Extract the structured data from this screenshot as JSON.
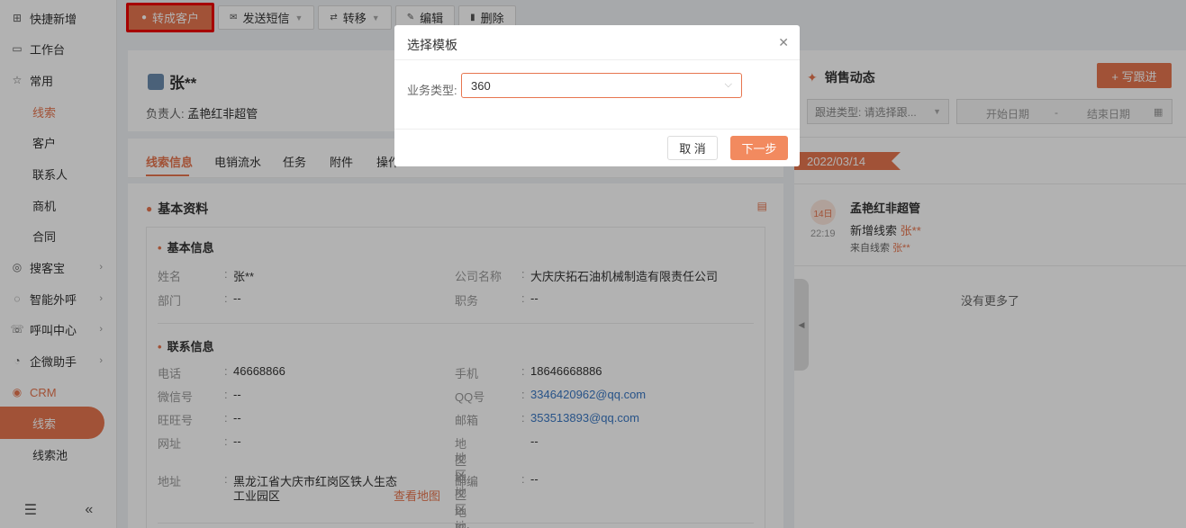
{
  "sidebar": {
    "items": [
      {
        "label": "快捷新增",
        "icon": "plus-square-icon"
      },
      {
        "label": "工作台",
        "icon": "monitor-icon"
      },
      {
        "label": "常用",
        "icon": "star-icon"
      },
      {
        "label": "线索"
      },
      {
        "label": "客户"
      },
      {
        "label": "联系人"
      },
      {
        "label": "商机"
      },
      {
        "label": "合同"
      },
      {
        "label": "搜客宝",
        "icon": "search-treasure-icon"
      },
      {
        "label": "智能外呼",
        "icon": "phone-bubble-icon"
      },
      {
        "label": "呼叫中心",
        "icon": "headset-icon"
      },
      {
        "label": "企微助手",
        "icon": "wecom-icon"
      },
      {
        "label": "CRM",
        "icon": "crm-icon"
      },
      {
        "label": "线索"
      },
      {
        "label": "线索池"
      }
    ]
  },
  "toolbar": {
    "convert": "转成客户",
    "sms": "发送短信",
    "transfer": "转移",
    "edit": "编辑",
    "delete": "删除"
  },
  "header": {
    "name": "张**",
    "owner_label": "负责人:",
    "owner": "孟艳红非超管"
  },
  "tabs": [
    "线索信息",
    "电销流水",
    "任务",
    "附件",
    "操作"
  ],
  "section": {
    "title": "基本资料",
    "basic_title": "基本信息",
    "contact_title": "联系信息"
  },
  "fields": {
    "name": {
      "k": "姓名",
      "v": "张**"
    },
    "company": {
      "k": "公司名称",
      "v": "大庆庆拓石油机械制造有限责任公司"
    },
    "dept": {
      "k": "部门",
      "v": "--"
    },
    "position": {
      "k": "职务",
      "v": "--"
    },
    "phone": {
      "k": "电话",
      "v": "46668866"
    },
    "mobile": {
      "k": "手机",
      "v": "18646668886"
    },
    "wechat": {
      "k": "微信号",
      "v": "--"
    },
    "qq": {
      "k": "QQ号",
      "v": "3346420962@qq.com"
    },
    "wangwang": {
      "k": "旺旺号",
      "v": "--"
    },
    "email": {
      "k": "邮箱",
      "v": "353513893@qq.com"
    },
    "website": {
      "k": "网址",
      "v": "--"
    },
    "region": {
      "k1": "地区地区地区:",
      "k2": "地区地区地区",
      "v": "--"
    },
    "address": {
      "k": "地址",
      "v1": "黑龙江省大庆市红岗区铁人生态",
      "v2": "工业园区",
      "map": "查看地图"
    },
    "zip": {
      "k": "邮编",
      "v": "--"
    }
  },
  "colon": ":",
  "right_panel": {
    "title": "销售动态",
    "write_btn": "+ 写跟进",
    "filter_placeholder": "跟进类型: 请选择跟...",
    "start_date": "开始日期",
    "date_sep": "-",
    "end_date": "结束日期",
    "date_flag": "2022/03/14",
    "day": "14日",
    "time": "22:19",
    "actor": "孟艳红非超管",
    "action_prefix": "新增线索",
    "action_target": "张**",
    "source_prefix": "来自线索",
    "source_target": "张**",
    "no_more": "没有更多了"
  },
  "modal": {
    "title": "选择模板",
    "label": "业务类型:",
    "value": "360",
    "cancel": "取 消",
    "next": "下一步"
  },
  "colors": {
    "accent": "#e7764f",
    "link": "#3a78c3",
    "highlight_border": "#ee0000"
  }
}
